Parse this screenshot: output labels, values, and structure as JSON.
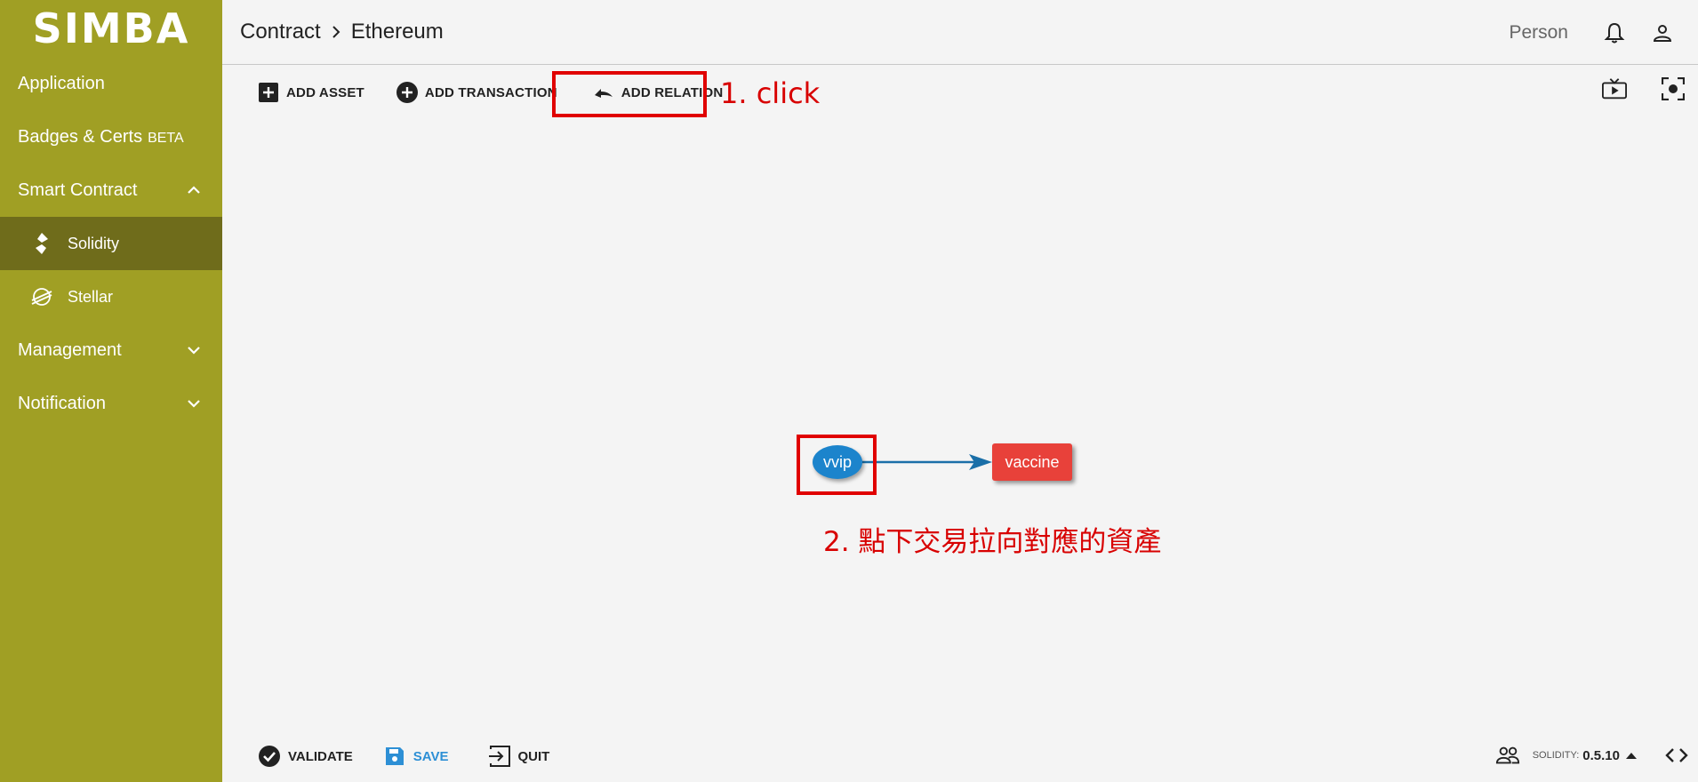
{
  "sidebar": {
    "logo": "SIMBA",
    "items": [
      {
        "label": "Application"
      },
      {
        "label": "Badges & Certs",
        "badge": "BETA"
      },
      {
        "label": "Smart Contract",
        "expanded": true
      },
      {
        "label": "Management",
        "expanded": false
      },
      {
        "label": "Notification",
        "expanded": false
      }
    ],
    "sub_items": [
      {
        "label": "Solidity",
        "active": true
      },
      {
        "label": "Stellar",
        "active": false
      }
    ]
  },
  "header": {
    "breadcrumb": [
      "Contract",
      "Ethereum"
    ],
    "person_label": "Person"
  },
  "toolbar": {
    "add_asset": "ADD ASSET",
    "add_transaction": "ADD TRANSACTION",
    "add_relation": "ADD RELATION"
  },
  "annotations": {
    "step1": "1. click",
    "step2": "2. 點下交易拉向對應的資產"
  },
  "canvas": {
    "transaction_node": "vvip",
    "asset_node": "vaccine"
  },
  "bottombar": {
    "validate": "VALIDATE",
    "save": "SAVE",
    "quit": "QUIT",
    "solidity_label": "SOLIDITY:",
    "solidity_version": "0.5.10"
  },
  "colors": {
    "sidebar_bg": "#a09f24",
    "sidebar_active": "#6f6c1b",
    "transaction_node": "#1c84cc",
    "asset_node": "#e8413a",
    "annotation": "#e00000",
    "save_accent": "#2d8fd5"
  }
}
